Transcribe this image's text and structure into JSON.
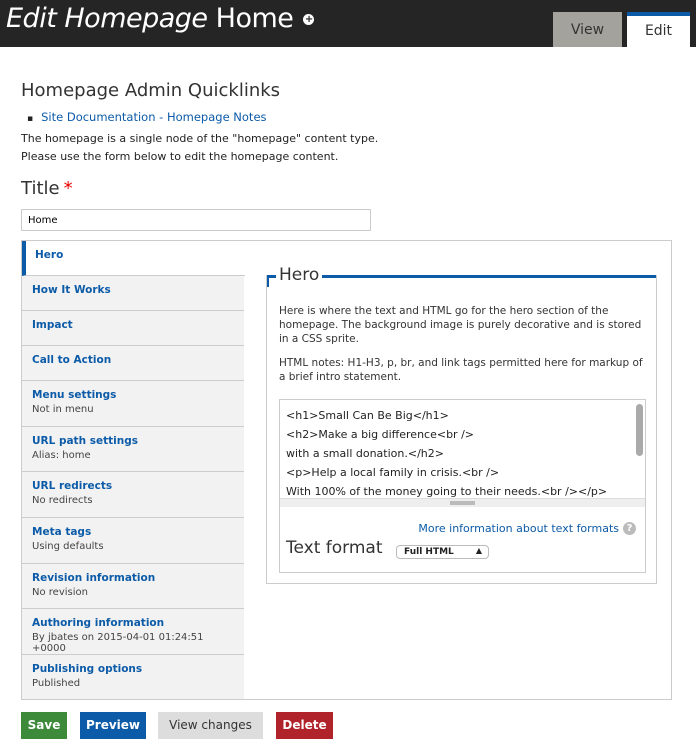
{
  "header": {
    "title_italic": "Edit Homepage",
    "title_rest": "Home",
    "tabs": [
      {
        "label": "View"
      },
      {
        "label": "Edit",
        "active": true
      }
    ]
  },
  "quicklinks": {
    "heading": "Homepage Admin Quicklinks",
    "link": "Site Documentation - Homepage Notes",
    "desc1": "The homepage is a single node of the \"homepage\" content type.",
    "desc2": "Please use the form below to edit the homepage content."
  },
  "title_field": {
    "label": "Title",
    "required_mark": "*",
    "value": "Home"
  },
  "vertical_tabs": [
    {
      "label": "Hero",
      "summary": ""
    },
    {
      "label": "How It Works",
      "summary": ""
    },
    {
      "label": "Impact",
      "summary": ""
    },
    {
      "label": "Call to Action",
      "summary": ""
    },
    {
      "label": "Menu settings",
      "summary": "Not in menu"
    },
    {
      "label": "URL path settings",
      "summary": "Alias: home"
    },
    {
      "label": "URL redirects",
      "summary": "No redirects"
    },
    {
      "label": "Meta tags",
      "summary": "Using defaults"
    },
    {
      "label": "Revision information",
      "summary": "No revision"
    },
    {
      "label": "Authoring information",
      "summary": "By jbates on 2015-04-01 01:24:51 +0000"
    },
    {
      "label": "Publishing options",
      "summary": "Published"
    }
  ],
  "hero": {
    "legend": "Hero",
    "desc": "Here is where the text and HTML go for the hero section of the homepage. The background image is purely decorative and is stored in a CSS sprite.",
    "notes": "HTML notes: H1-H3, p, br, and link tags permitted here for markup of a brief intro statement.",
    "body": "<h1>Small Can Be Big</h1>\n<h2>Make a big difference<br />\nwith a small donation.</h2>\n<p>Help a local family in crisis.<br />\nWith 100% of the money going to their needs.<br /></p>\n<p>Local families in crisis often need help.</p>",
    "more_info": "More information about text formats",
    "text_format_label": "Text format",
    "text_format_value": "Full HTML"
  },
  "actions": {
    "save": "Save",
    "preview": "Preview",
    "view_changes": "View changes",
    "delete": "Delete"
  },
  "colors": {
    "primary": "#0c5ba8",
    "save": "#3d8a3b",
    "delete": "#b0232a"
  }
}
